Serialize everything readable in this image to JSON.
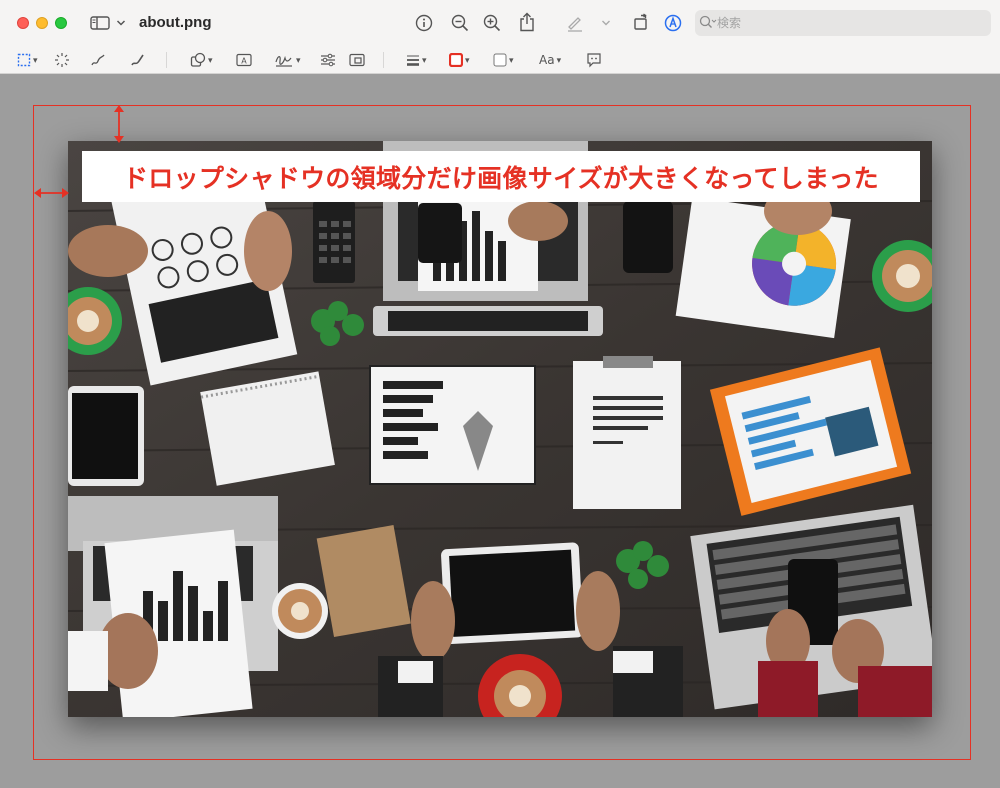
{
  "window": {
    "title": "about.png"
  },
  "search": {
    "placeholder": "検索",
    "value": ""
  },
  "toolbar": {
    "title_icons": [
      "sidebar-icon",
      "info-icon",
      "zoom-out-icon",
      "zoom-in-icon",
      "share-icon",
      "highlight-pen-icon",
      "rotate-icon",
      "markup-icon"
    ],
    "markup_tools": [
      "rectangular-selection-icon",
      "instant-alpha-icon",
      "sketch-icon",
      "draw-icon",
      "shapes-icon",
      "text-icon",
      "sign-icon",
      "adjust-color-icon",
      "adjust-size-icon",
      "shape-style-icon",
      "border-color-icon",
      "fill-color-icon",
      "text-style-icon",
      "description-icon"
    ],
    "text_style_label": "Aa",
    "border_color": "#e53124",
    "fill_color": "#ffffff"
  },
  "annotation": {
    "caption": "ドロップシャドウの領域分だけ画像サイズが大きくなってしまった",
    "frame_color": "#e53124"
  },
  "colors": {
    "titlebar": "#f5f4f3",
    "canvas": "#9d9d9d",
    "accent_blue": "#2a6ff0"
  }
}
